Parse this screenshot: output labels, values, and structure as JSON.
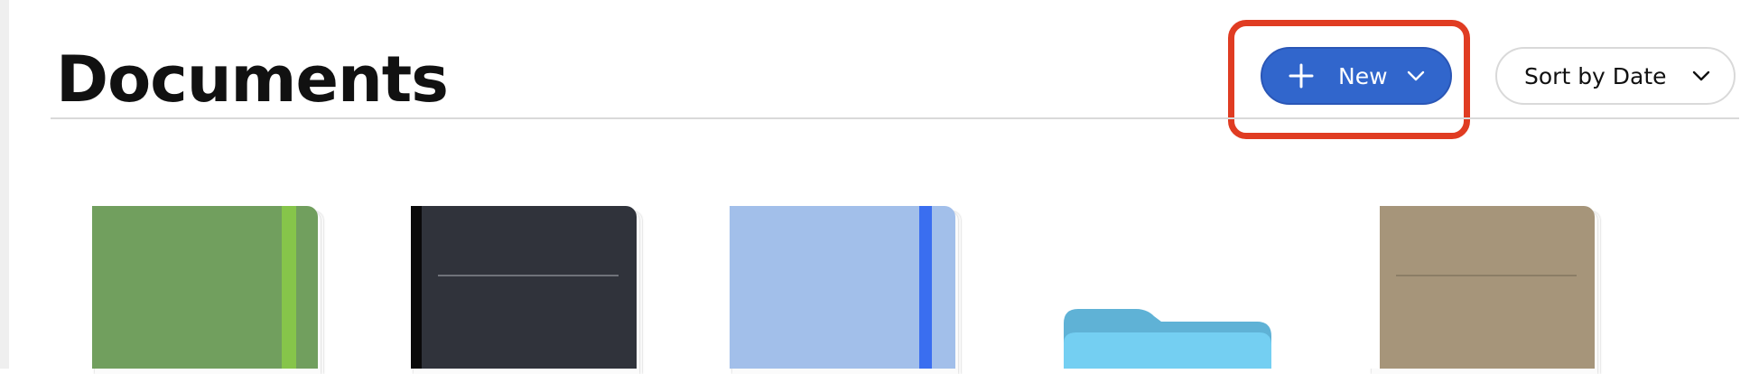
{
  "page": {
    "title": "Documents"
  },
  "toolbar": {
    "new_label": "New",
    "sort_label": "Sort by Date"
  },
  "icons": {
    "new_button": "plus-icon",
    "dropdowns": "chevron-down-icon"
  },
  "colors": {
    "accent": "#3166cc",
    "highlight": "#e03c22"
  },
  "documents": [
    {
      "type": "notebook",
      "cover_color": "#719f5e",
      "band_color": "#86c54a"
    },
    {
      "type": "notebook",
      "cover_color": "#30333b",
      "band_color": "#0a0a0a"
    },
    {
      "type": "notebook",
      "cover_color": "#a2bfea",
      "band_color": "#3a6ef0"
    },
    {
      "type": "folder",
      "cover_color": "#6ed0f4"
    },
    {
      "type": "notebook",
      "cover_color": "#a6957a",
      "band_color": "#ffffff"
    }
  ]
}
